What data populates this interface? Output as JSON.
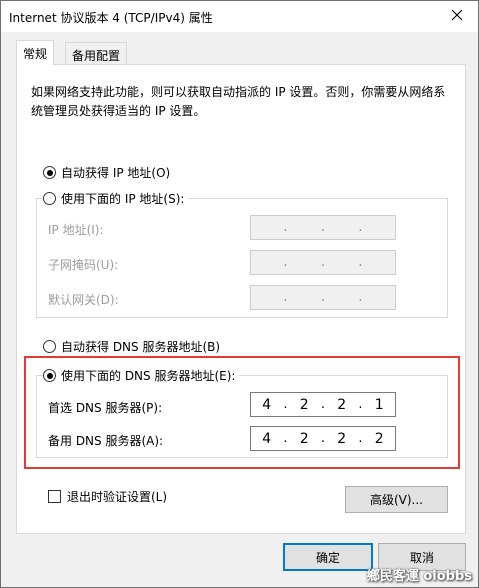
{
  "window": {
    "title": "Internet 协议版本 4 (TCP/IPv4) 属性"
  },
  "tabs": [
    {
      "label": "常规",
      "active": true
    },
    {
      "label": "备用配置",
      "active": false
    }
  ],
  "description": "如果网络支持此功能，则可以获取自动指派的 IP 设置。否则，你需要从网络系统管理员处获得适当的 IP 设置。",
  "ip_section": {
    "auto_label": "自动获得 IP 地址(O)",
    "manual_label": "使用下面的 IP 地址(S):",
    "selected": "auto",
    "fields": [
      {
        "label": "IP 地址(I):",
        "octets": [
          "",
          "",
          "",
          ""
        ]
      },
      {
        "label": "子网掩码(U):",
        "octets": [
          "",
          "",
          "",
          ""
        ]
      },
      {
        "label": "默认网关(D):",
        "octets": [
          "",
          "",
          "",
          ""
        ]
      }
    ]
  },
  "dns_section": {
    "auto_label": "自动获得 DNS 服务器地址(B)",
    "manual_label": "使用下面的 DNS 服务器地址(E):",
    "selected": "manual",
    "preferred": {
      "label": "首选 DNS 服务器(P):",
      "octets": [
        "4",
        "2",
        "2",
        "1"
      ]
    },
    "alternate": {
      "label": "备用 DNS 服务器(A):",
      "octets": [
        "4",
        "2",
        "2",
        "2"
      ]
    }
  },
  "validate_checkbox": {
    "label": "退出时验证设置(L)",
    "checked": false
  },
  "buttons": {
    "advanced": "高级(V)...",
    "ok": "确定",
    "cancel": "取消"
  },
  "watermark": "鄉民客運 olobbs",
  "colors": {
    "highlight_frame": "#e53935",
    "default_button_border": "#0078d7"
  }
}
